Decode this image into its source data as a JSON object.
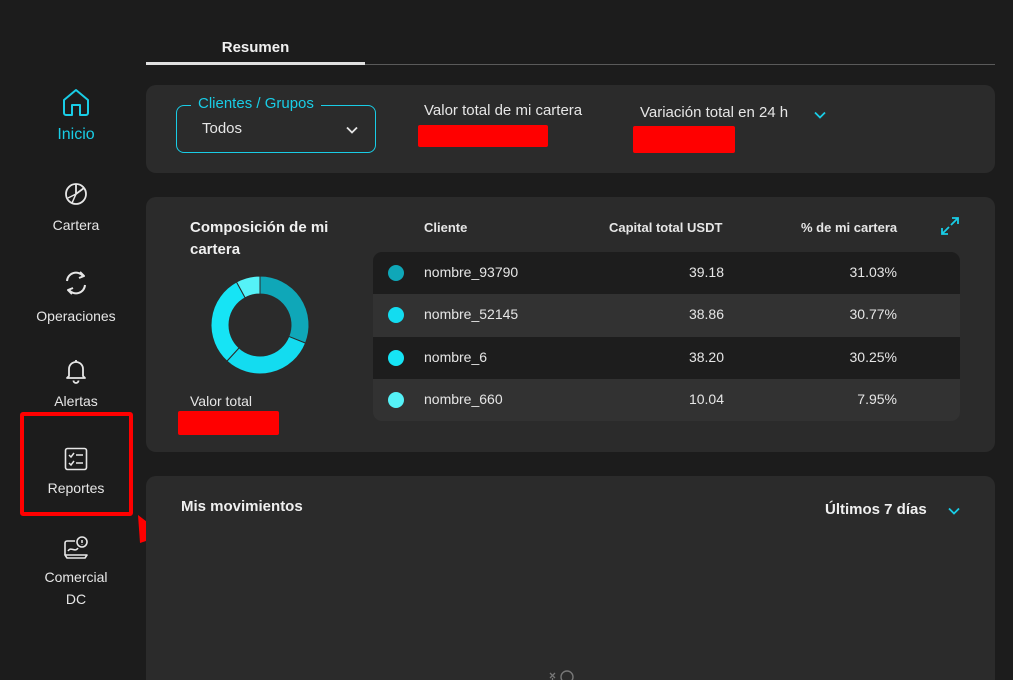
{
  "sidebar": {
    "items": [
      {
        "label": "Inicio",
        "icon": "home-icon"
      },
      {
        "label": "Cartera",
        "icon": "pie-chart-icon"
      },
      {
        "label": "Operaciones",
        "icon": "exchange-arrows-icon"
      },
      {
        "label": "Alertas",
        "icon": "bell-icon"
      },
      {
        "label": "Reportes",
        "icon": "checklist-report-icon"
      },
      {
        "label": "Comercial",
        "label2": "DC",
        "icon": "commercial-icon"
      }
    ]
  },
  "tabs": [
    {
      "label": "Resumen"
    }
  ],
  "summary": {
    "select": {
      "legend": "Clientes / Grupos",
      "value": "Todos"
    },
    "total_label": "Valor total de mi cartera",
    "variation_label": "Variación total en 24 h"
  },
  "composition": {
    "title": "Composición de mi cartera",
    "total_label": "Valor total",
    "headers": {
      "client": "Cliente",
      "capital": "Capital total USDT",
      "percent": "% de mi cartera"
    },
    "rows": [
      {
        "name": "nombre_93790",
        "capital": "39.18",
        "percent": "31.03%",
        "pct": 31.03,
        "color": "#0fa7b8"
      },
      {
        "name": "nombre_52145",
        "capital": "38.86",
        "percent": "30.77%",
        "pct": 30.77,
        "color": "#13dcf0"
      },
      {
        "name": "nombre_6",
        "capital": "38.20",
        "percent": "30.25%",
        "pct": 30.25,
        "color": "#16e4f5"
      },
      {
        "name": "nombre_660",
        "capital": "10.04",
        "percent": "7.95%",
        "pct": 7.95,
        "color": "#55f2f7"
      }
    ]
  },
  "movements": {
    "title": "Mis movimientos",
    "period": "Últimos 7 días"
  },
  "colors": {
    "accent": "#19cde6",
    "card": "#2b2b2b",
    "background": "#1c1c1c",
    "annotation": "#ff0000"
  }
}
